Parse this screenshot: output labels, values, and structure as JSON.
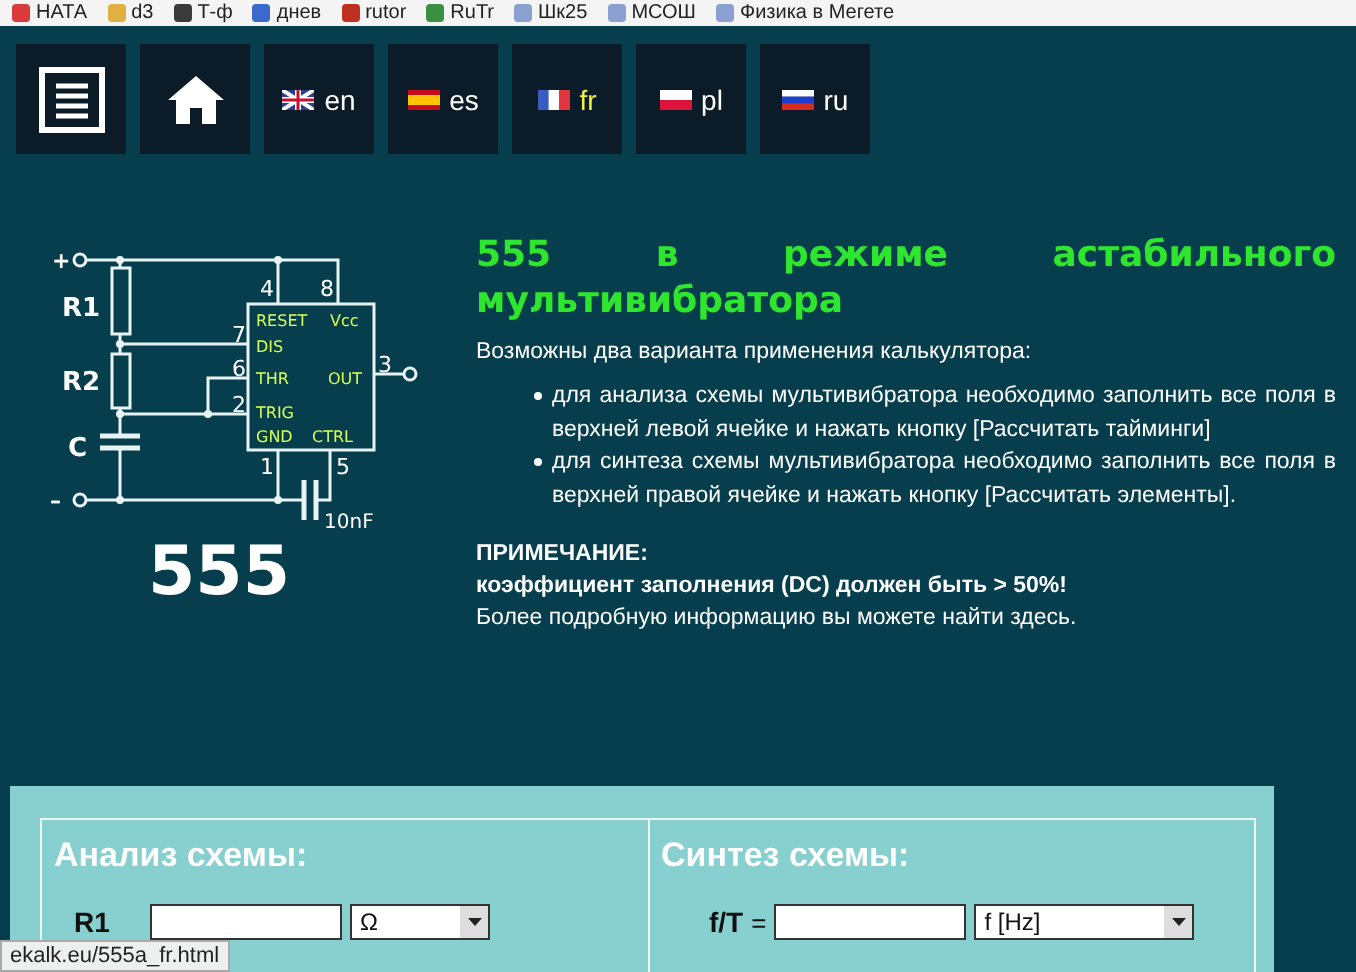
{
  "bookmarks": [
    "НАТА",
    "d3",
    "Т-ф",
    "днев",
    "rutor",
    "RuTr",
    "Шк25",
    "МСОШ",
    "Физика в Мегете"
  ],
  "nav": {
    "languages": [
      {
        "code": "en",
        "selected": false
      },
      {
        "code": "es",
        "selected": false
      },
      {
        "code": "fr",
        "selected": true
      },
      {
        "code": "pl",
        "selected": false
      },
      {
        "code": "ru",
        "selected": false
      }
    ]
  },
  "circuit": {
    "labels": [
      "+",
      "–",
      "R1",
      "R2",
      "C",
      "4",
      "8",
      "7",
      "6",
      "2",
      "3",
      "1",
      "5",
      "RESET",
      "Vcc",
      "DIS",
      "THR",
      "OUT",
      "TRIG",
      "GND",
      "CTRL",
      "10nF"
    ],
    "chip": "555"
  },
  "article": {
    "title": "555 в режиме астабильного мультивибратора",
    "intro": "Возможны два варианта применения калькулятора:",
    "bullets": [
      "для анализа схемы мультивибратора необходимо заполнить все поля в верхней левой ячейке и нажать кнопку [Рассчитать тайминги]",
      "для синтеза схемы мультивибратора необходимо заполнить все поля в верхней правой ячейке и нажать кнопку [Рассчитать элементы]."
    ],
    "note_heading": "ПРИМЕЧАНИЕ:",
    "note": "коэффициент заполнения (DC) должен быть > 50%!",
    "more": "Более подробную информацию вы можете найти здесь."
  },
  "calculator": {
    "analysis": {
      "heading": "Анализ схемы:",
      "label": "R1",
      "unit": "Ω"
    },
    "synthesis": {
      "heading": "Синтез схемы:",
      "label": "f/T",
      "equals": "=",
      "unit": "f [Hz]"
    }
  },
  "status_url": "ekalk.eu/555a_fr.html"
}
